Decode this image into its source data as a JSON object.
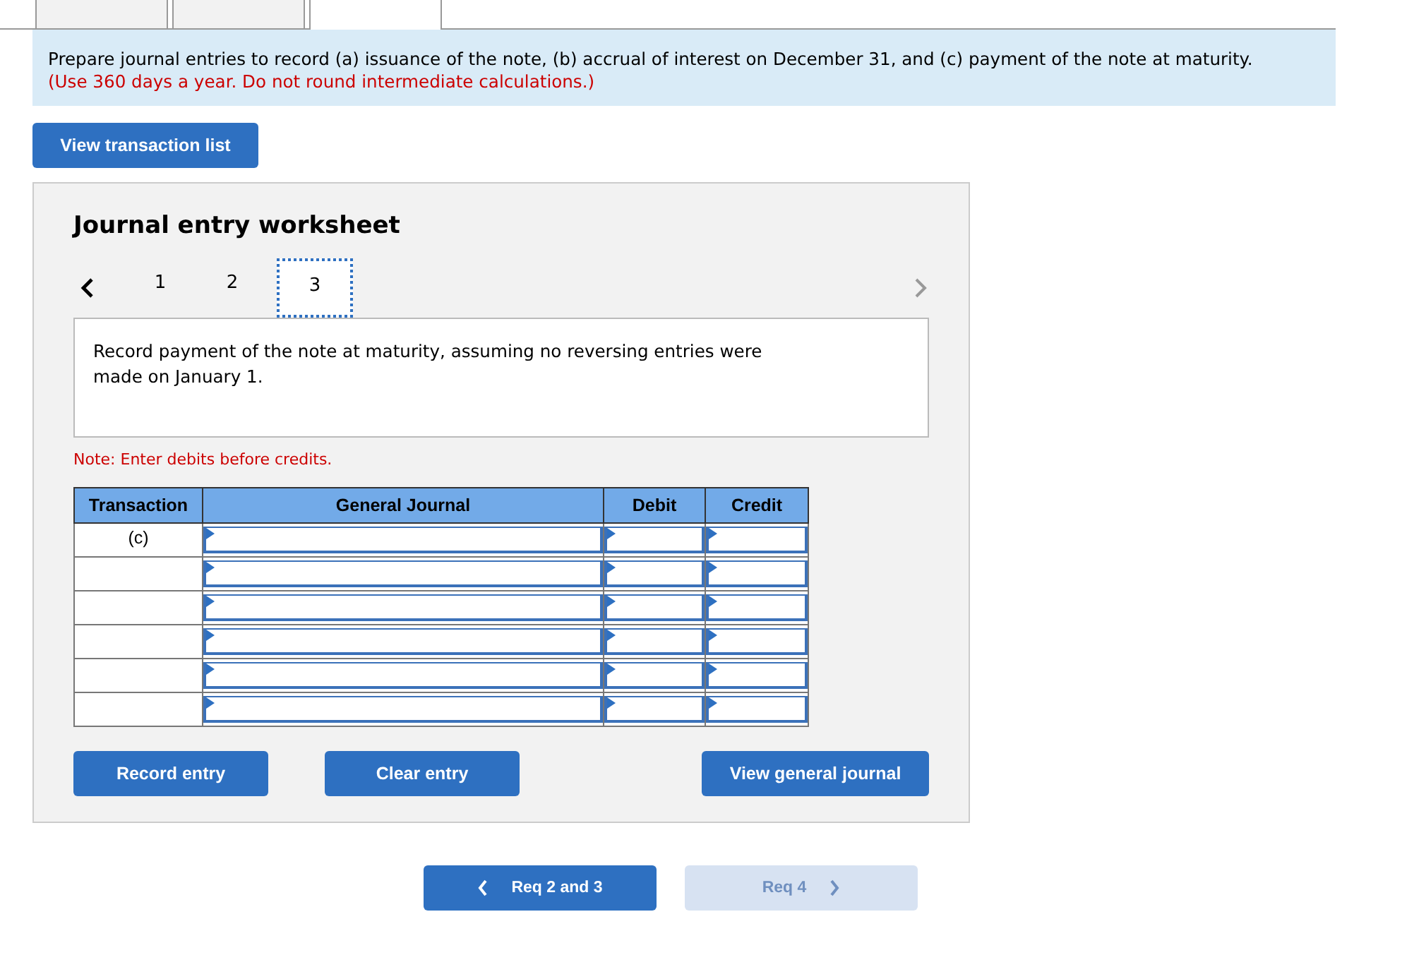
{
  "req_tabs": [
    {
      "selected": false
    },
    {
      "selected": false
    },
    {
      "selected": true
    }
  ],
  "instructions": {
    "text": "Prepare journal entries to record (a) issuance of the note, (b) accrual of interest on December 31, and (c) payment of the note at maturity.",
    "hint": "(Use 360 days a year. Do not round intermediate calculations.)"
  },
  "view_transaction_list": "View transaction list",
  "worksheet": {
    "title": "Journal entry worksheet",
    "steps": [
      {
        "label": "1",
        "selected": false
      },
      {
        "label": "2",
        "selected": false
      },
      {
        "label": "3",
        "selected": true
      }
    ],
    "description": "Record payment of the note at maturity, assuming no reversing entries were made on January 1.",
    "note": "Note: Enter debits before credits.",
    "columns": [
      "Transaction",
      "General Journal",
      "Debit",
      "Credit"
    ],
    "rows": [
      {
        "transaction": "(c)"
      },
      {},
      {},
      {},
      {},
      {}
    ],
    "buttons": [
      "Record entry",
      "Clear entry",
      "View general journal"
    ]
  },
  "nav": [
    {
      "label": "Req 2 and 3",
      "kind": "prev",
      "disabled": false
    },
    {
      "label": "Req 4",
      "kind": "next",
      "disabled": true
    }
  ]
}
